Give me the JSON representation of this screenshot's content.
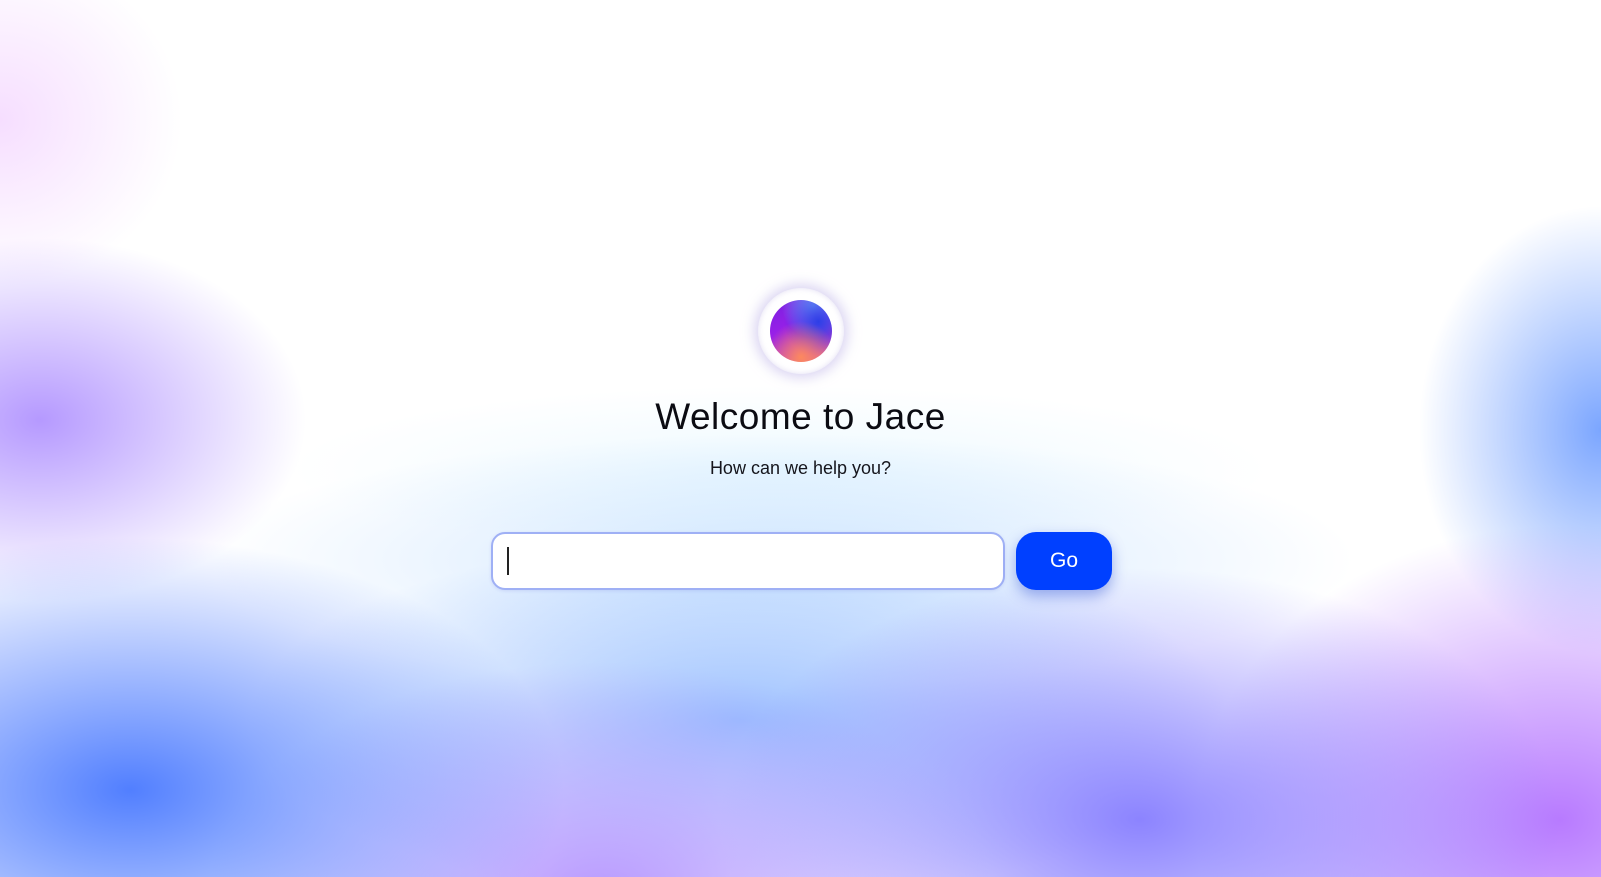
{
  "hero": {
    "logo_icon": "gradient-orb-logo",
    "title": "Welcome to Jace",
    "subtitle": "How can we help you?"
  },
  "search": {
    "value": "",
    "placeholder": ""
  },
  "go_button": {
    "label": "Go",
    "color": "#0040ff"
  }
}
